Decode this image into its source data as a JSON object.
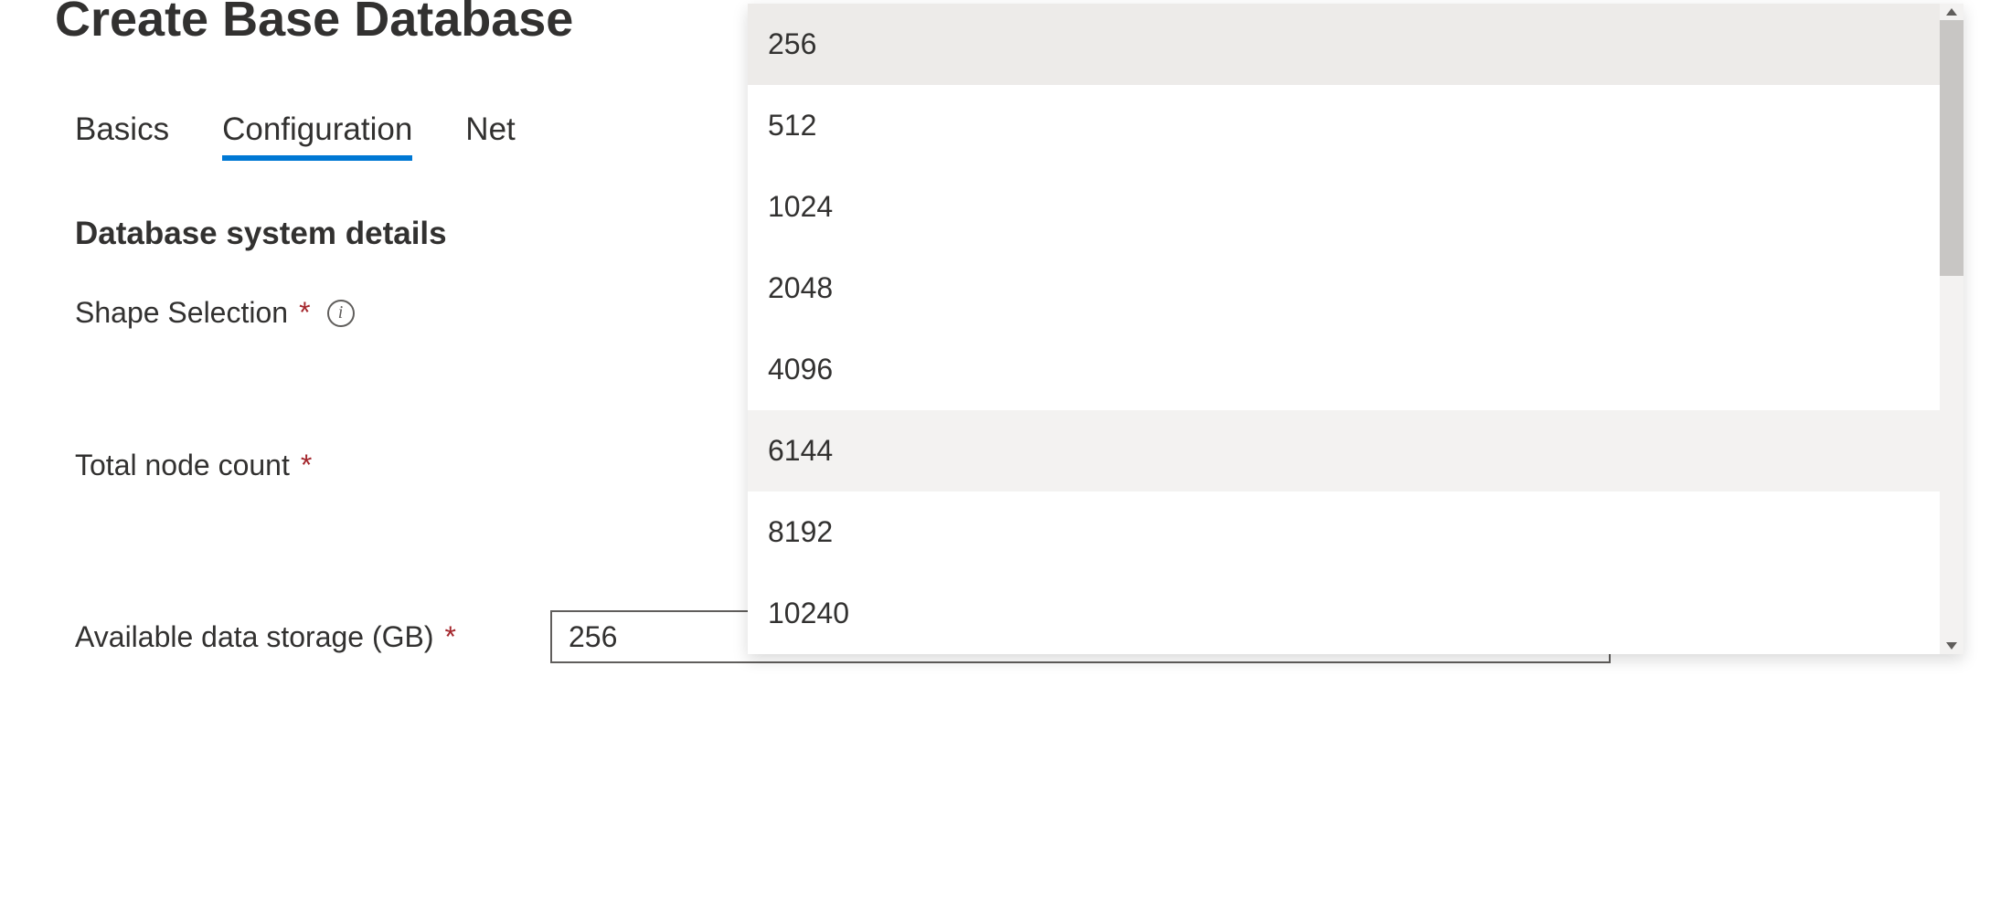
{
  "page": {
    "title": "Create Base Database"
  },
  "tabs": {
    "basics": "Basics",
    "configuration": "Configuration",
    "networking": "Net"
  },
  "section": {
    "heading": "Database system details"
  },
  "fields": {
    "shape": {
      "label": "Shape Selection"
    },
    "node_count": {
      "label": "Total node count"
    },
    "storage": {
      "label": "Available data storage (GB)",
      "value": "256"
    }
  },
  "dropdown": {
    "options": [
      "256",
      "512",
      "1024",
      "2048",
      "4096",
      "6144",
      "8192",
      "10240"
    ]
  }
}
